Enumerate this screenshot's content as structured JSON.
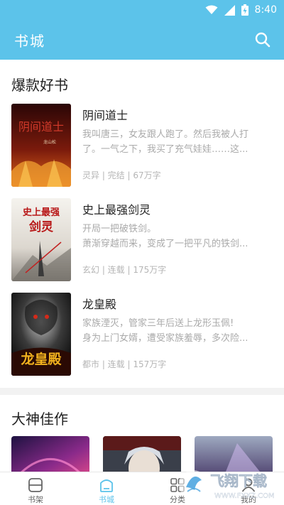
{
  "status_bar": {
    "time": "8:40",
    "icons": [
      "wifi-icon",
      "signal-icon",
      "battery-icon"
    ]
  },
  "app_bar": {
    "title": "书城",
    "search_icon": "search-icon"
  },
  "sections": {
    "hot": {
      "title": "爆款好书",
      "books": [
        {
          "title": "阴间道士",
          "desc_line1": "我叫唐三，女友跟人跑了。然后我被人打",
          "desc_line2": "了。一气之下，我买了充气娃娃……这...",
          "meta": "灵异 | 完结 | 67万字",
          "cover_text": "阴间道士",
          "cover_author": "龙山松"
        },
        {
          "title": "史上最强剑灵",
          "desc_line1": "开局一把破铁剑。",
          "desc_line2": "萧渐穿越而来，变成了一把平凡的铁剑...",
          "meta": "玄幻 | 连载 | 175万字",
          "cover_text_1": "史上最强",
          "cover_text_2": "剑灵"
        },
        {
          "title": "龙皇殿",
          "desc_line1": "家族湮灭，管家三年后送上龙形玉佩!",
          "desc_line2": "身为上门女婿，遭受家族羞辱，多次险...",
          "meta": "都市 | 连载 | 157万字",
          "cover_text": "龙皇殿"
        }
      ]
    },
    "masters": {
      "title": "大神佳作"
    }
  },
  "bottom_nav": [
    {
      "label": "书架",
      "icon": "bookshelf-icon",
      "active": false
    },
    {
      "label": "书城",
      "icon": "bookstore-icon",
      "active": true
    },
    {
      "label": "分类",
      "icon": "category-icon",
      "active": false
    },
    {
      "label": "我的",
      "icon": "profile-icon",
      "active": false
    }
  ],
  "watermark": {
    "text": "飞翔下载",
    "url_text": "WWW.FXXZ.COM"
  },
  "colors": {
    "accent": "#5cc3ea",
    "text_primary": "#222222",
    "text_secondary": "#aaaaaa"
  }
}
